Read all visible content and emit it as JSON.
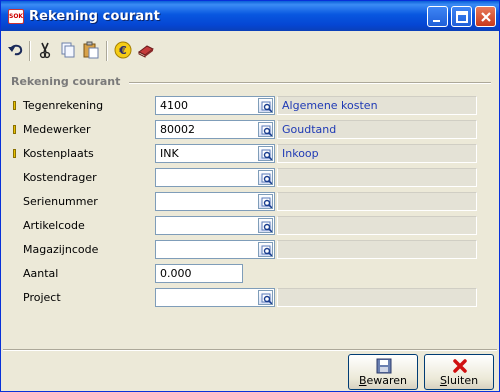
{
  "window": {
    "title": "Rekening courant",
    "app_icon_text": "SOK"
  },
  "toolbar": {
    "icons": [
      "undo-icon",
      "scissors-icon",
      "copy-icon",
      "paste-icon",
      "euro-icon",
      "book-icon"
    ]
  },
  "group": {
    "title": "Rekening courant"
  },
  "fields": [
    {
      "label": "Tegenrekening",
      "value": "4100",
      "description": "Algemene kosten",
      "required": true
    },
    {
      "label": "Medewerker",
      "value": "80002",
      "description": "Goudtand",
      "required": true
    },
    {
      "label": "Kostenplaats",
      "value": "INK",
      "description": "Inkoop",
      "required": true
    },
    {
      "label": "Kostendrager",
      "value": "",
      "description": "",
      "required": false
    },
    {
      "label": "Serienummer",
      "value": "",
      "description": "",
      "required": false
    },
    {
      "label": "Artikelcode",
      "value": "",
      "description": "",
      "required": false
    },
    {
      "label": "Magazijncode",
      "value": "",
      "description": "",
      "required": false
    },
    {
      "label": "Aantal",
      "value": "0.000",
      "required": false
    },
    {
      "label": "Project",
      "value": "",
      "description": "",
      "required": false
    }
  ],
  "buttons": {
    "save": {
      "accel": "B",
      "rest": "ewaren"
    },
    "close": {
      "accel": "S",
      "rest": "luiten"
    }
  },
  "colors": {
    "title_bar": "#0556d6",
    "description_text": "#1f3ab5",
    "required_marker": "#e9c100"
  }
}
